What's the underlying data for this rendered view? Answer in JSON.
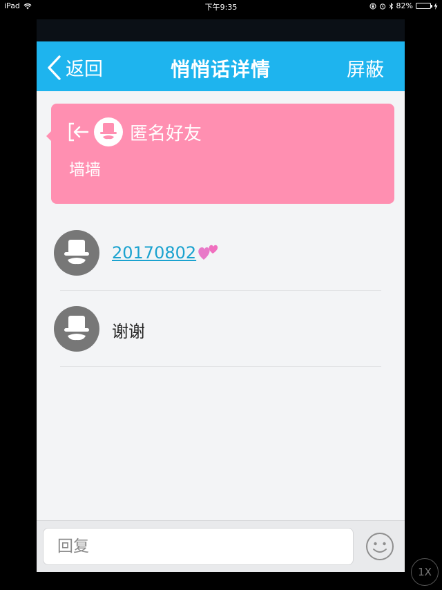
{
  "status_bar": {
    "device": "iPad",
    "time": "下午9:35",
    "battery": "82%",
    "battery_level": 0.82,
    "wifi_icon": "wifi-icon",
    "orientation_lock_icon": "rotation-lock-icon",
    "alarm_icon": "alarm-icon",
    "bluetooth_icon": "bluetooth-icon",
    "charging_icon": "charging-bolt-icon"
  },
  "navbar": {
    "back_label": "返回",
    "title": "悄悄话详情",
    "block_label": "屏蔽",
    "color": "#1eb4ee"
  },
  "whisper_card": {
    "name": "匿名好友",
    "message": "墙墙",
    "color": "#ff8fb1",
    "exit_icon": "exit-arrow-icon",
    "avatar_icon": "anonymous-hat-avatar"
  },
  "replies": [
    {
      "text": "20170802",
      "is_link": true,
      "emoji": "two-hearts-icon"
    },
    {
      "text": "谢谢",
      "is_link": false
    }
  ],
  "input_bar": {
    "placeholder": "回复",
    "emoji_icon": "smiley-icon"
  },
  "scale_button": "1X"
}
